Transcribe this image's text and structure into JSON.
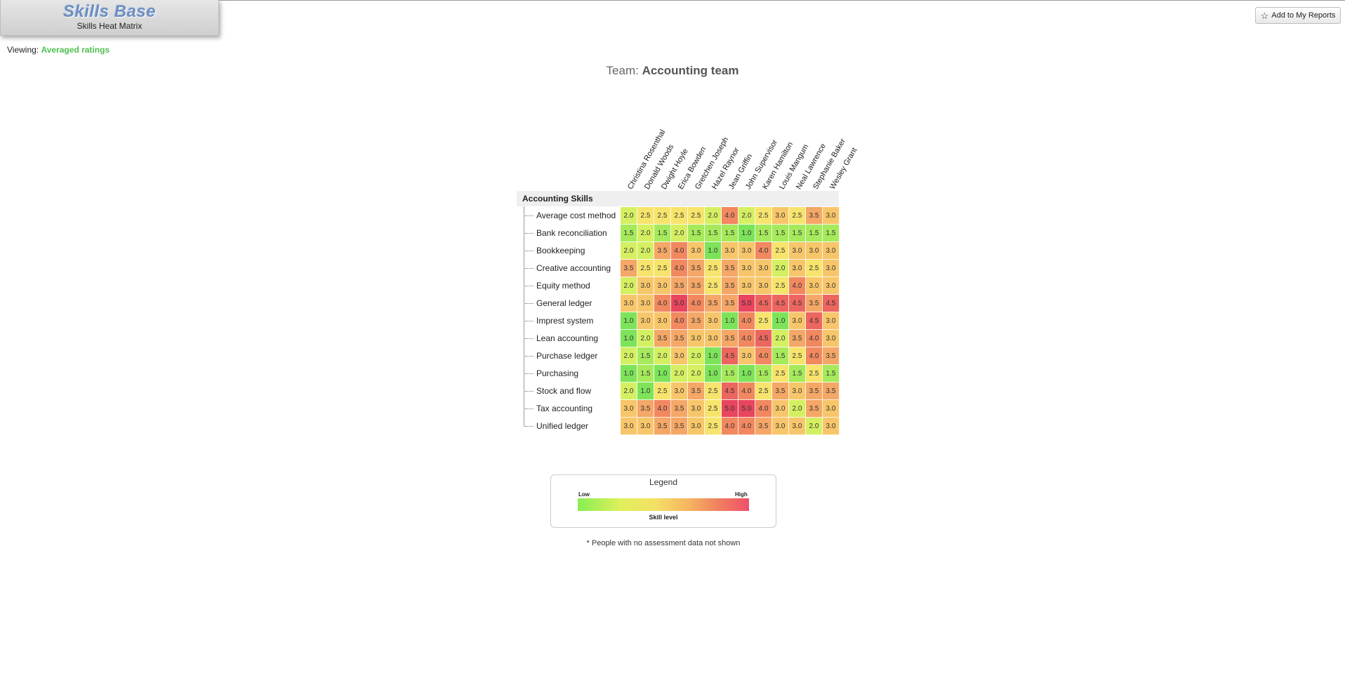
{
  "header": {
    "brand_name": "Skills Base",
    "brand_subtitle": "Skills Heat Matrix",
    "add_report_label": "Add to My Reports"
  },
  "viewing": {
    "label": "Viewing:",
    "mode": "Averaged ratings"
  },
  "team": {
    "label": "Team:",
    "name": "Accounting team"
  },
  "matrix": {
    "group_name": "Accounting Skills",
    "people": [
      "Christina Rosenthal",
      "Donald Woods",
      "Dwight Hoyle",
      "Erica Bowden",
      "Gretchen Joseph",
      "Hazel Raynor",
      "Jean Griffin",
      "John Supervisor",
      "Karen Hamilton",
      "Louis Mangum",
      "Neal Lawrence",
      "Stephanie Baker",
      "Wesley Grant"
    ],
    "skills": [
      "Average cost method",
      "Bank reconciliation",
      "Bookkeeping",
      "Creative accounting",
      "Equity method",
      "General ledger",
      "Imprest system",
      "Lean accounting",
      "Purchase ledger",
      "Purchasing",
      "Stock and flow",
      "Tax accounting",
      "Unified ledger"
    ],
    "ratings": [
      [
        "2.0",
        "2.5",
        "2.5",
        "2.5",
        "2.5",
        "2.0",
        "4.0",
        "2.0",
        "2.5",
        "3.0",
        "2.5",
        "3.5",
        "3.0"
      ],
      [
        "1.5",
        "2.0",
        "1.5",
        "2.0",
        "1.5",
        "1.5",
        "1.5",
        "1.0",
        "1.5",
        "1.5",
        "1.5",
        "1.5",
        "1.5"
      ],
      [
        "2.0",
        "2.0",
        "3.5",
        "4.0",
        "3.0",
        "1.0",
        "3.0",
        "3.0",
        "4.0",
        "2.5",
        "3.0",
        "3.0",
        "3.0"
      ],
      [
        "3.5",
        "2.5",
        "2.5",
        "4.0",
        "3.5",
        "2.5",
        "3.5",
        "3.0",
        "3.0",
        "2.0",
        "3.0",
        "2.5",
        "3.0"
      ],
      [
        "2.0",
        "3.0",
        "3.0",
        "3.5",
        "3.5",
        "2.5",
        "3.5",
        "3.0",
        "3.0",
        "2.5",
        "4.0",
        "3.0",
        "3.0"
      ],
      [
        "3.0",
        "3.0",
        "4.0",
        "5.0",
        "4.0",
        "3.5",
        "3.5",
        "5.0",
        "4.5",
        "4.5",
        "4.5",
        "3.5",
        "4.5"
      ],
      [
        "1.0",
        "3.0",
        "3.0",
        "4.0",
        "3.5",
        "3.0",
        "1.0",
        "4.0",
        "2.5",
        "1.0",
        "3.0",
        "4.5",
        "3.0"
      ],
      [
        "1.0",
        "2.0",
        "3.5",
        "3.5",
        "3.0",
        "3.0",
        "3.5",
        "4.0",
        "4.5",
        "2.0",
        "3.5",
        "4.0",
        "3.0"
      ],
      [
        "2.0",
        "1.5",
        "2.0",
        "3.0",
        "2.0",
        "1.0",
        "4.5",
        "3.0",
        "4.0",
        "1.5",
        "2.5",
        "4.0",
        "3.5"
      ],
      [
        "1.0",
        "1.5",
        "1.0",
        "2.0",
        "2.0",
        "1.0",
        "1.5",
        "1.0",
        "1.5",
        "2.5",
        "1.5",
        "2.5",
        "1.5"
      ],
      [
        "2.0",
        "1.0",
        "2.5",
        "3.0",
        "3.5",
        "2.5",
        "4.5",
        "4.0",
        "2.5",
        "3.5",
        "3.0",
        "3.5",
        "3.5"
      ],
      [
        "3.0",
        "3.5",
        "4.0",
        "3.5",
        "3.0",
        "2.5",
        "5.0",
        "5.0",
        "4.0",
        "3.0",
        "2.0",
        "3.5",
        "3.0"
      ],
      [
        "3.0",
        "3.0",
        "3.5",
        "3.5",
        "3.0",
        "2.5",
        "4.0",
        "4.0",
        "3.5",
        "3.0",
        "3.0",
        "2.0",
        "3.0"
      ]
    ],
    "colors": {
      "1.0": "#7de35a",
      "1.5": "#a6ea5c",
      "2.0": "#d4f062",
      "2.5": "#f7e46c",
      "3.0": "#f8c66a",
      "3.5": "#f4a766",
      "4.0": "#f1885f",
      "4.5": "#ec665f",
      "5.0": "#e8455e"
    }
  },
  "legend": {
    "title": "Legend",
    "low": "Low",
    "high": "High",
    "caption": "Skill level"
  },
  "footnote": "* People with no assessment data not shown"
}
